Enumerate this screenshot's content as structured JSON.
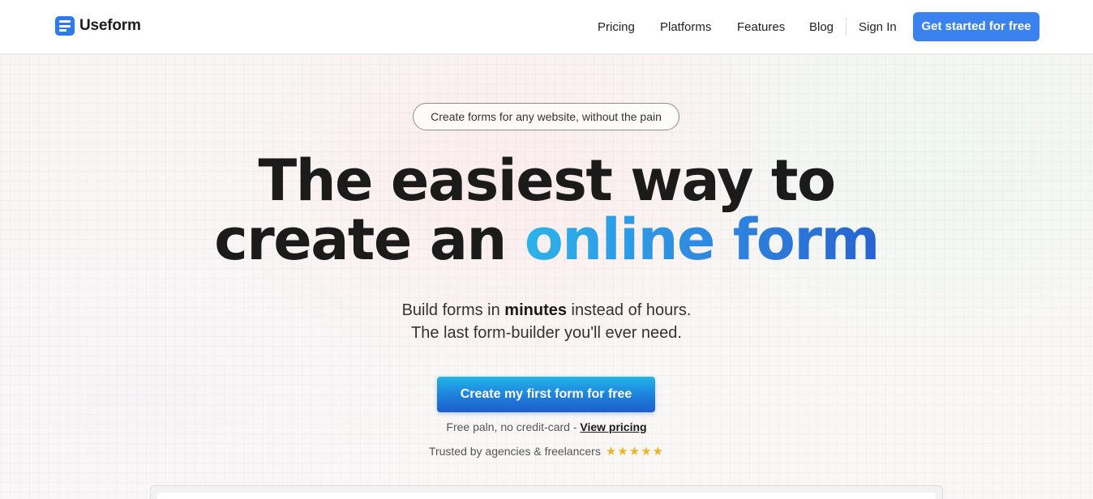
{
  "header": {
    "brand": "Useform",
    "nav": [
      "Pricing",
      "Platforms",
      "Features",
      "Blog"
    ],
    "sign_in": "Sign In",
    "cta": "Get started for free"
  },
  "hero": {
    "pill": "Create forms for any website, without the pain",
    "title_line1": "The easiest way to",
    "title_line2_plain": "create an ",
    "title_line2_accent": "online form",
    "sub_line1_pre": "Build forms in ",
    "sub_line1_bold": "minutes",
    "sub_line1_post": " instead of hours.",
    "sub_line2": "The last form-builder you'll ever need.",
    "cta": "Create my first form for free",
    "note_pre": "Free paln, no credit-card - ",
    "note_link": "View pricing",
    "trust": "Trusted by agencies & freelancers",
    "stars": "★★★★★",
    "rating_stars": 5
  },
  "colors": {
    "accent": "#3a82f0",
    "gradient_start": "#2bb3ea",
    "gradient_end": "#2763cf",
    "star": "#f0b429"
  }
}
